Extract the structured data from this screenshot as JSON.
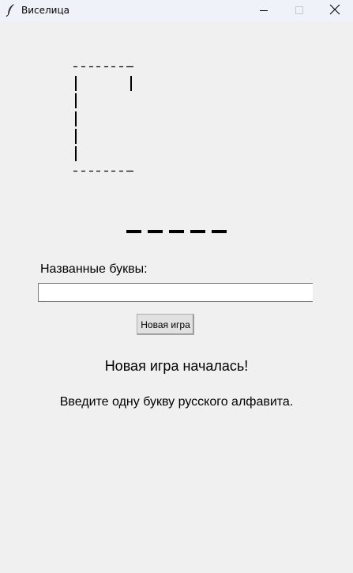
{
  "window": {
    "title": "Виселица",
    "icon": "feather-icon",
    "controls": [
      "minimize-icon",
      "maximize-icon",
      "close-icon"
    ]
  },
  "gallows": {
    "top_line": "- - - - - - - -",
    "bottom_line": "- - - - - - - -"
  },
  "word": {
    "length": 5
  },
  "named_letters": {
    "label": "Названные буквы:",
    "value": "",
    "placeholder": ""
  },
  "buttons": {
    "new_game": "Новая игра"
  },
  "status": {
    "message": "Новая игра началась!",
    "hint": "Введите одну букву русского алфавита."
  }
}
